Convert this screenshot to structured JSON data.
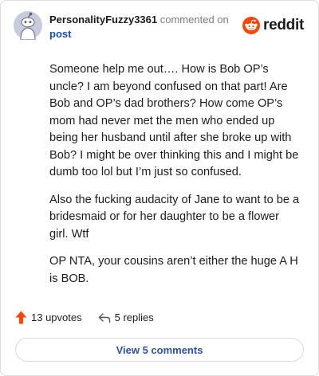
{
  "header": {
    "username": "PersonalityFuzzy3361",
    "action_text": "commented on",
    "post_link": "post"
  },
  "brand": {
    "name": "reddit",
    "icon": "reddit-logo-icon",
    "color": "#ff4500"
  },
  "comment": {
    "paragraphs": [
      "Someone help me out…. How is Bob OP’s uncle? I am beyond confused on that part! Are Bob and OP’s dad brothers? How come OP’s mom had never met the men who ended up being her husband until after she broke up with Bob? I might be over thinking this and I might be dumb too lol but I’m just so confused.",
      "Also the fucking audacity of Jane to want to be a bridesmaid or for her daughter to be a flower girl. Wtf",
      "OP NTA, your cousins aren’t either the huge A H is BOB."
    ]
  },
  "actions": {
    "upvotes": "13 upvotes",
    "upvote_icon": "upvote-arrow-icon",
    "upvote_color": "#ff4500",
    "replies": "5 replies",
    "reply_icon": "reply-icon"
  },
  "view_button": {
    "label": "View 5 comments",
    "color": "#2b52a3"
  }
}
